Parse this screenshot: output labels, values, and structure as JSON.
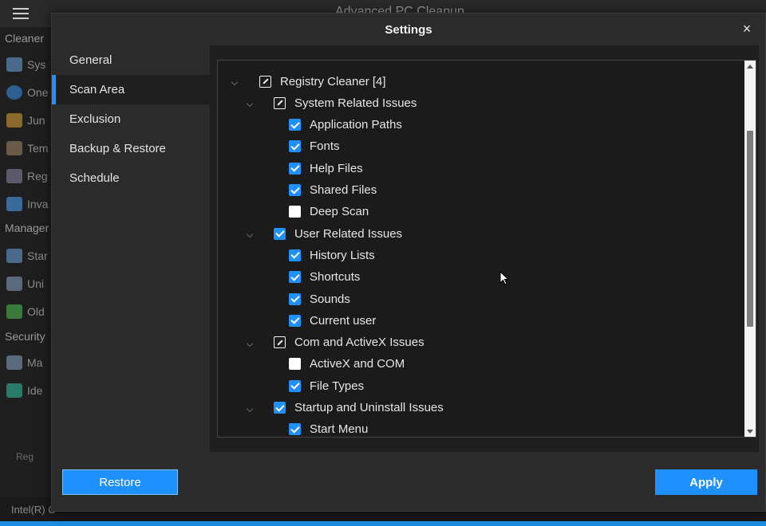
{
  "background_app": {
    "title": "Advanced PC Cleanup",
    "sections": [
      "Cleaner",
      "Manager",
      "Security"
    ],
    "items_partial": [
      "Sys",
      "One",
      "Jun",
      "Tem",
      "Reg",
      "Inva",
      "Star",
      "Uni",
      "Old",
      "Ma",
      "Ide"
    ],
    "status_text": "Intel(R) C",
    "check_text": "Reg"
  },
  "dialog": {
    "title": "Settings",
    "close_label": "×"
  },
  "nav": {
    "items": [
      {
        "label": "General",
        "active": false
      },
      {
        "label": "Scan Area",
        "active": true
      },
      {
        "label": "Exclusion",
        "active": false
      },
      {
        "label": "Backup & Restore",
        "active": false
      },
      {
        "label": "Schedule",
        "active": false
      }
    ]
  },
  "tree": {
    "items": [
      {
        "label": "Registry Cleaner [4]",
        "level": 0,
        "state": "partial",
        "expander": true
      },
      {
        "label": "System Related Issues",
        "level": 1,
        "state": "partial",
        "expander": true
      },
      {
        "label": "Application Paths",
        "level": 2,
        "state": "checked"
      },
      {
        "label": "Fonts",
        "level": 2,
        "state": "checked"
      },
      {
        "label": "Help Files",
        "level": 2,
        "state": "checked"
      },
      {
        "label": "Shared Files",
        "level": 2,
        "state": "checked"
      },
      {
        "label": "Deep Scan",
        "level": 2,
        "state": "unchecked"
      },
      {
        "label": "User Related Issues",
        "level": 1,
        "state": "checked",
        "expander": true
      },
      {
        "label": "History Lists",
        "level": 2,
        "state": "checked"
      },
      {
        "label": "Shortcuts",
        "level": 2,
        "state": "checked"
      },
      {
        "label": "Sounds",
        "level": 2,
        "state": "checked"
      },
      {
        "label": "Current user",
        "level": 2,
        "state": "checked"
      },
      {
        "label": "Com and ActiveX Issues",
        "level": 1,
        "state": "partial",
        "expander": true
      },
      {
        "label": "ActiveX and COM",
        "level": 2,
        "state": "unchecked"
      },
      {
        "label": "File Types",
        "level": 2,
        "state": "checked"
      },
      {
        "label": "Startup and Uninstall Issues",
        "level": 1,
        "state": "checked",
        "expander": true
      },
      {
        "label": "Start Menu",
        "level": 2,
        "state": "checked"
      }
    ]
  },
  "buttons": {
    "restore_label": "Restore",
    "apply_label": "Apply"
  },
  "colors": {
    "accent": "#1e90ff",
    "dialog_bg": "#2b2b2b",
    "content_bg": "#1f1f1f"
  }
}
